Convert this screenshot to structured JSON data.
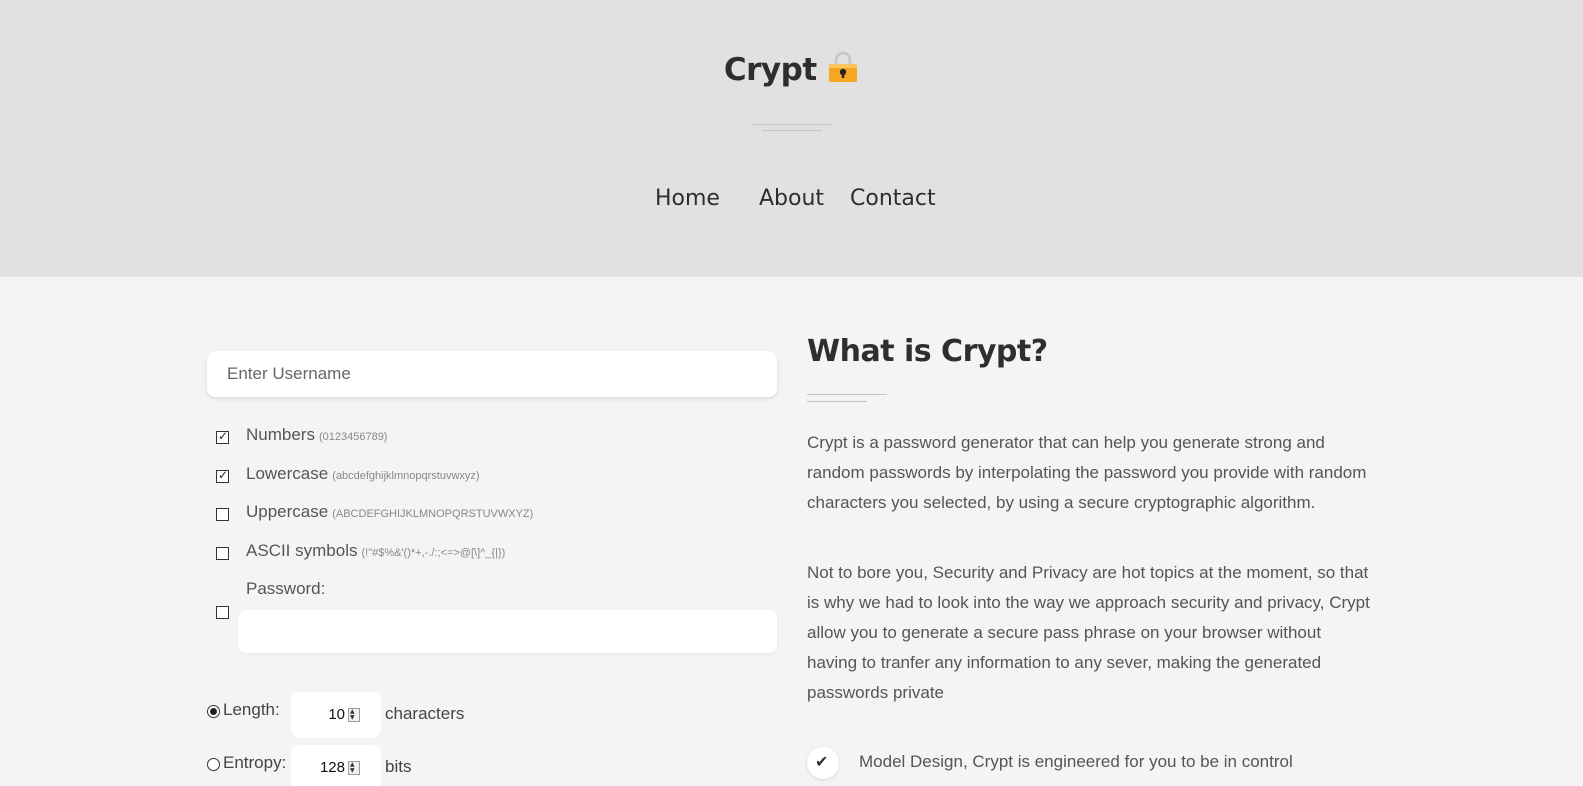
{
  "header": {
    "brand": "Crypt",
    "brand_icon": "lock-icon",
    "nav": [
      "Home",
      "About",
      "Contact"
    ]
  },
  "form": {
    "username_placeholder": "Enter Username",
    "options": [
      {
        "label": "Numbers",
        "hint": "(0123456789)",
        "checked": true
      },
      {
        "label": "Lowercase",
        "hint": "(abcdefghijklmnopqrstuvwxyz)",
        "checked": true
      },
      {
        "label": "Uppercase",
        "hint": "(ABCDEFGHIJKLMNOPQRSTUVWXYZ)",
        "checked": false
      },
      {
        "label": "ASCII symbols",
        "hint": "(!\"#$%&'()*+,-./:;<=>@[\\]^_{|})",
        "checked": false
      },
      {
        "label": "Password:",
        "hint": "",
        "checked": false
      }
    ],
    "password_value": "",
    "length": {
      "label": "Length:",
      "value": "10",
      "unit": "characters",
      "selected": true
    },
    "entropy": {
      "label": "Entropy:",
      "value": "128",
      "unit": "bits",
      "selected": false
    }
  },
  "about": {
    "title": "What is Crypt?",
    "para1": "Crypt is a password generator that can help you generate strong and random passwords by interpolating the password you provide with random characters you selected, by using a secure cryptographic algorithm.",
    "para2": "Not to bore you, Security and Privacy are hot topics at the moment, so that is why we had to look into the way we approach security and privacy, Crypt allow you to generate a secure pass phrase on your browser without having to tranfer any information to any sever, making the generated passwords private",
    "feature1": "Model Design, Crypt is engineered for you to be in control",
    "feature_icon": "check-icon"
  },
  "colors": {
    "header_bg": "#e1e1e1",
    "page_bg": "#f4f4f4",
    "lock": "#f5a623"
  }
}
